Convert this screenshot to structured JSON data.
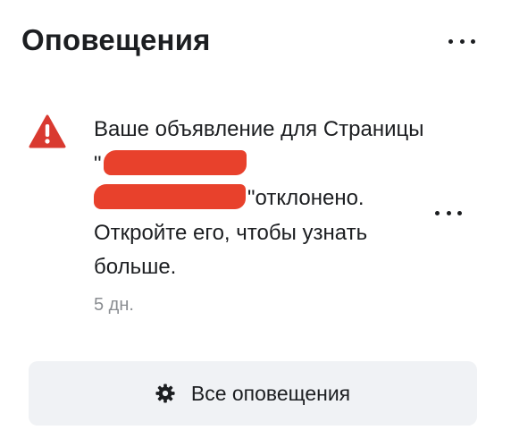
{
  "header": {
    "title": "Оповещения"
  },
  "notification": {
    "text_part1": "Ваше объявление для Страницы \"",
    "text_part2": "\"отклонено. Откройте его, чтобы узнать больше.",
    "time": "5 дн.",
    "icon": "warning-triangle-icon",
    "icon_color": "#d93a30"
  },
  "footer": {
    "all_label": "Все оповещения",
    "icon": "gear-icon"
  },
  "colors": {
    "redaction": "#e8412c",
    "button_bg": "#f0f2f5",
    "muted_text": "#8a8d91"
  }
}
